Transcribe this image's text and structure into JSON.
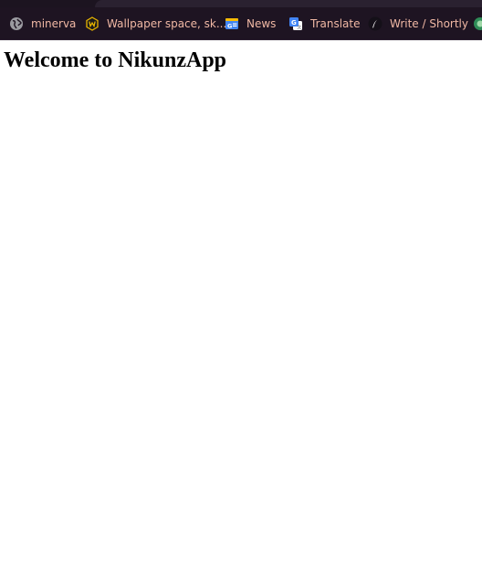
{
  "bookmarks": [
    {
      "label": "minerva",
      "icon": "globe-icon"
    },
    {
      "label": "Wallpaper space, sk...",
      "icon": "wallpaper-shield-icon"
    },
    {
      "label": "News",
      "icon": "google-news-icon"
    },
    {
      "label": "Translate",
      "icon": "google-translate-icon"
    },
    {
      "label": "Write / Shortly",
      "icon": "feather-icon"
    },
    {
      "label": "",
      "icon": "partial-green-icon"
    }
  ],
  "page": {
    "heading": "Welcome to NikunzApp"
  },
  "colors": {
    "bookmarks_bar_bg": "#1e1422",
    "bookmark_text": "#f0b8a4",
    "page_bg": "#ffffff",
    "heading_text": "#000000"
  }
}
